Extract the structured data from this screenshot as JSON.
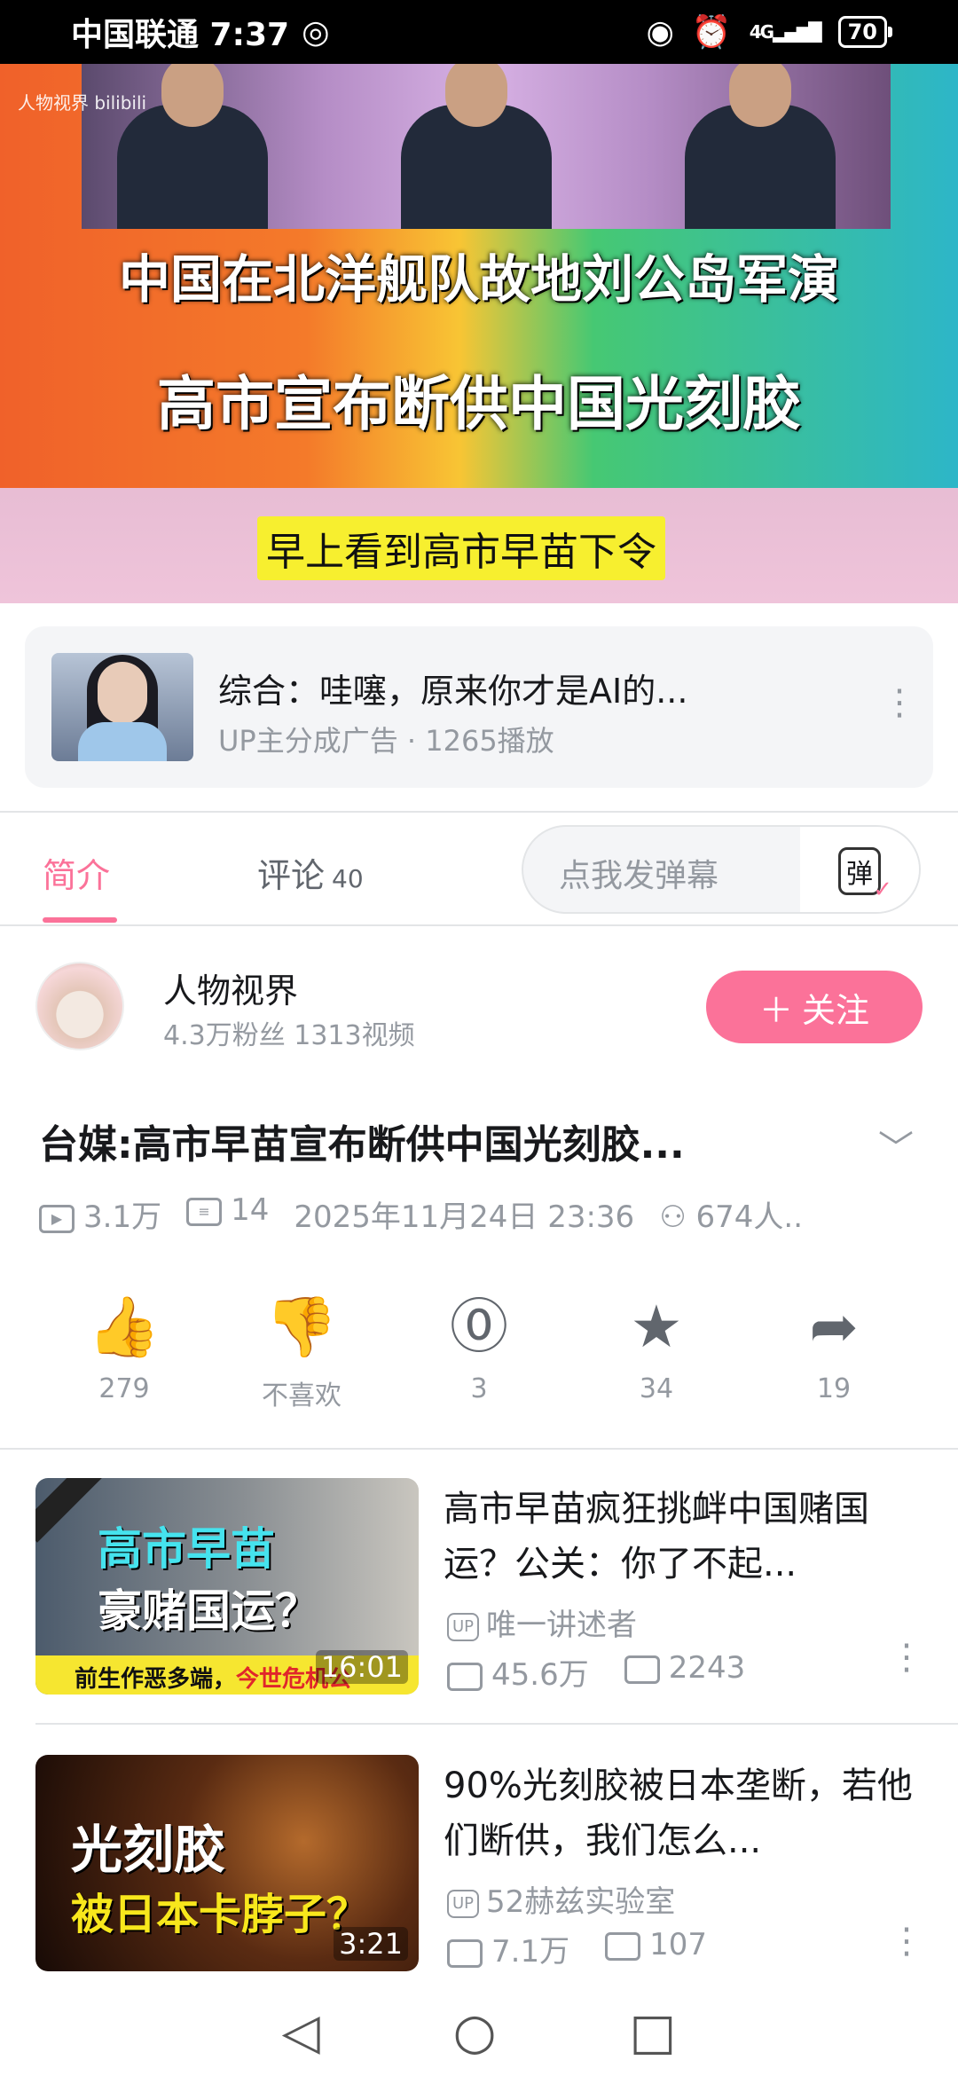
{
  "status_bar": {
    "carrier_time": "中国联通 7:37",
    "network": "4G",
    "battery": "70"
  },
  "player": {
    "watermark": "人物视界 bilibili",
    "caption_line1": "中国在北洋舰队故地刘公岛军演",
    "caption_line2": "高市宣布断供中国光刻胶",
    "caption_line3": "早上看到高市早苗下令"
  },
  "ad": {
    "title": "综合：哇噻，原来你才是AI的...",
    "subtitle": "UP主分成广告 · 1265播放"
  },
  "tabs": {
    "intro": "简介",
    "comments": "评论",
    "comments_count": "40",
    "danmu_placeholder": "点我发弹幕",
    "danmu_toggle": "弹"
  },
  "author": {
    "name": "人物视界",
    "stats": "4.3万粉丝    1313视频",
    "follow": "关注"
  },
  "video": {
    "title": "台媒:高市早苗宣布断供中国光刻胶...",
    "views": "3.1万",
    "danmaku": "14",
    "date": "2025年11月24日 23:36",
    "watching": "674人.."
  },
  "actions": [
    {
      "icon": "like-icon",
      "label": "279"
    },
    {
      "icon": "dislike-icon",
      "label": "不喜欢"
    },
    {
      "icon": "coin-icon",
      "label": "3"
    },
    {
      "icon": "star-icon",
      "label": "34"
    },
    {
      "icon": "share-icon",
      "label": "19"
    }
  ],
  "recommendations": [
    {
      "title": "高市早苗疯狂挑衅中国赌国运？公关：你了不起...",
      "uploader": "唯一讲述者",
      "up_badge": "UP",
      "views": "45.6万",
      "danmaku": "2243",
      "duration": "16:01",
      "thumb_line1": "高市早苗",
      "thumb_line2": "豪赌国运？",
      "thumb_bar_a": "前生作恶多端，",
      "thumb_bar_b": "今世危机公关!"
    },
    {
      "title": "90%光刻胶被日本垄断，若他们断供，我们怎么...",
      "uploader": "52赫兹实验室",
      "up_badge": "UP",
      "views": "7.1万",
      "danmaku": "107",
      "duration": "3:21",
      "thumb_line1": "光刻胶",
      "thumb_line2": "被日本卡脖子？"
    }
  ],
  "colors": {
    "accent": "#fb7299",
    "muted": "#9499a0"
  }
}
